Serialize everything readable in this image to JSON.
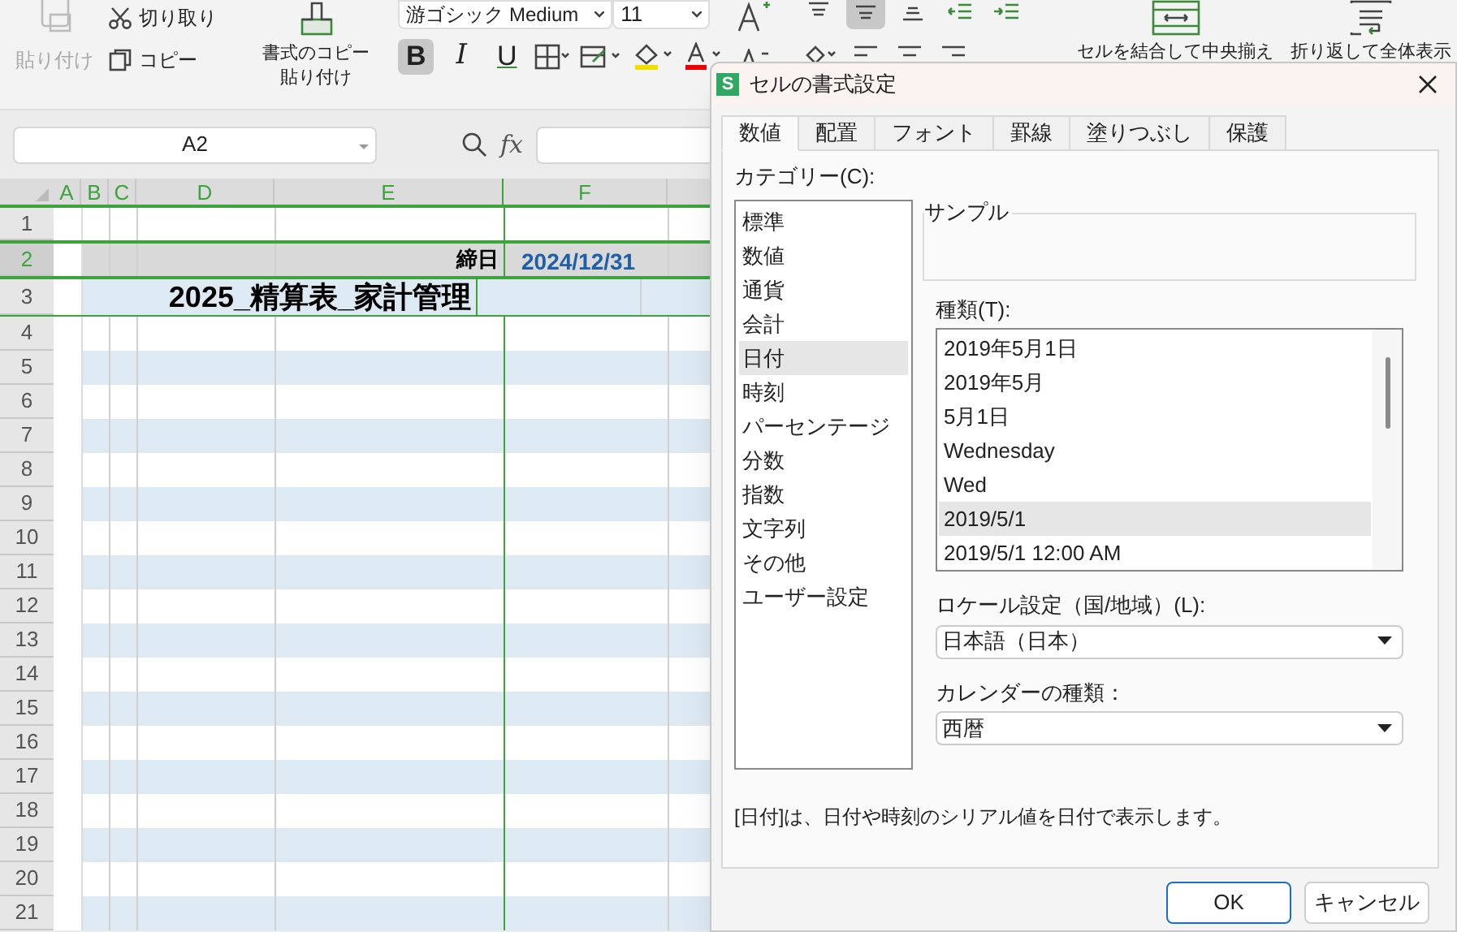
{
  "ribbon": {
    "paste": {
      "label": "貼り付け",
      "disabled": true
    },
    "cut": {
      "label": "切り取り"
    },
    "copy": {
      "label": "コピー"
    },
    "format_painter": {
      "lines": [
        "書式のコピー",
        "貼り付け"
      ]
    },
    "font_name": "游ゴシック Medium",
    "font_size": "11",
    "font_buttons": [
      {
        "kind": "bold",
        "label": "B",
        "selected": true
      },
      {
        "kind": "italic",
        "label": "I",
        "selected": false
      },
      {
        "kind": "underline",
        "label": "U",
        "selected": false
      }
    ],
    "align_buttons": [
      {
        "kind": "top",
        "selected": false
      },
      {
        "kind": "middle",
        "selected": true
      },
      {
        "kind": "bottom",
        "selected": false
      },
      {
        "kind": "outdent",
        "selected": false
      },
      {
        "kind": "indent",
        "selected": false
      }
    ],
    "merge": {
      "label": "セルを結合して中央揃え"
    },
    "wrap": {
      "label": "折り返して全体表示"
    }
  },
  "formula_bar": {
    "name_box": "A2",
    "fx": "fx"
  },
  "sheet": {
    "columns": [
      {
        "label": "A"
      },
      {
        "label": "B"
      },
      {
        "label": "C"
      },
      {
        "label": "D"
      },
      {
        "label": "E"
      },
      {
        "label": "F"
      }
    ],
    "rows": [
      {
        "number": "1",
        "kind": "plain",
        "selected": false
      },
      {
        "number": "2",
        "kind": "header",
        "selected": true,
        "label": "締日",
        "value": "2024/12/31"
      },
      {
        "number": "3",
        "kind": "banded",
        "selected": false,
        "title": "2025_精算表_家計管理"
      },
      {
        "number": "4",
        "kind": "plain",
        "selected": false
      },
      {
        "number": "5",
        "kind": "banded",
        "selected": false
      },
      {
        "number": "6",
        "kind": "plain",
        "selected": false
      },
      {
        "number": "7",
        "kind": "banded",
        "selected": false
      },
      {
        "number": "8",
        "kind": "plain",
        "selected": false
      },
      {
        "number": "9",
        "kind": "banded",
        "selected": false
      },
      {
        "number": "10",
        "kind": "plain",
        "selected": false
      },
      {
        "number": "11",
        "kind": "banded",
        "selected": false
      },
      {
        "number": "12",
        "kind": "plain",
        "selected": false
      },
      {
        "number": "13",
        "kind": "banded",
        "selected": false
      },
      {
        "number": "14",
        "kind": "plain",
        "selected": false
      },
      {
        "number": "15",
        "kind": "banded",
        "selected": false
      },
      {
        "number": "16",
        "kind": "plain",
        "selected": false
      },
      {
        "number": "17",
        "kind": "banded",
        "selected": false
      },
      {
        "number": "18",
        "kind": "plain",
        "selected": false
      },
      {
        "number": "19",
        "kind": "banded",
        "selected": false
      },
      {
        "number": "20",
        "kind": "plain",
        "selected": false
      },
      {
        "number": "21",
        "kind": "banded",
        "selected": false
      }
    ]
  },
  "dialog": {
    "logo": "S",
    "title": "セルの書式設定",
    "tabs": [
      {
        "label": "数値",
        "selected": true
      },
      {
        "label": "配置",
        "selected": false
      },
      {
        "label": "フォント",
        "selected": false
      },
      {
        "label": "罫線",
        "selected": false
      },
      {
        "label": "塗りつぶし",
        "selected": false
      },
      {
        "label": "保護",
        "selected": false
      }
    ],
    "category_label": "カテゴリー(C):",
    "categories": [
      {
        "label": "標準",
        "selected": false
      },
      {
        "label": "数値",
        "selected": false
      },
      {
        "label": "通貨",
        "selected": false
      },
      {
        "label": "会計",
        "selected": false
      },
      {
        "label": "日付",
        "selected": true
      },
      {
        "label": "時刻",
        "selected": false
      },
      {
        "label": "パーセンテージ",
        "selected": false
      },
      {
        "label": "分数",
        "selected": false
      },
      {
        "label": "指数",
        "selected": false
      },
      {
        "label": "文字列",
        "selected": false
      },
      {
        "label": "その他",
        "selected": false
      },
      {
        "label": "ユーザー設定",
        "selected": false
      }
    ],
    "sample_label": "サンプル",
    "type_label": "種類(T):",
    "types": [
      {
        "label": "2019年5月1日",
        "selected": false
      },
      {
        "label": "2019年5月",
        "selected": false
      },
      {
        "label": "5月1日",
        "selected": false
      },
      {
        "label": "Wednesday",
        "selected": false
      },
      {
        "label": "Wed",
        "selected": false
      },
      {
        "label": "2019/5/1",
        "selected": true
      },
      {
        "label": "2019/5/1 12:00 AM",
        "selected": false
      }
    ],
    "locale_label": "ロケール設定（国/地域）(L):",
    "locale_value": "日本語（日本）",
    "calendar_label": "カレンダーの種類：",
    "calendar_value": "西暦",
    "description": "[日付]は、日付や時刻のシリアル値を日付で表示します。",
    "buttons": [
      {
        "label": "OK",
        "kind": "primary"
      },
      {
        "label": "キャンセル",
        "kind": "secondary"
      }
    ]
  }
}
